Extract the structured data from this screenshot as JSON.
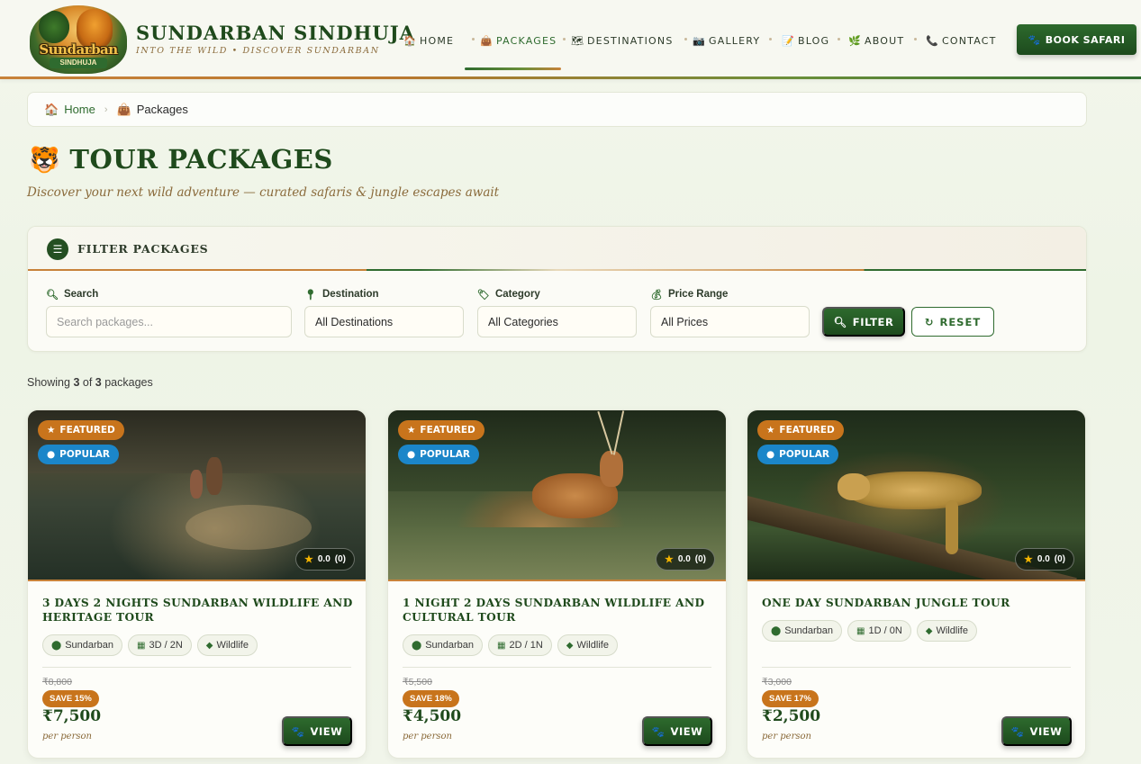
{
  "brand": {
    "logo_text": "Sundarban",
    "logo_subtext": "SINDHUJA",
    "title": "SUNDARBAN SINDHUJA",
    "tagline": "INTO THE WILD  •  DISCOVER SUNDARBAN"
  },
  "nav": {
    "items": [
      {
        "label": "HOME",
        "icon": "home-icon"
      },
      {
        "label": "PACKAGES",
        "icon": "bag-icon",
        "active": true
      },
      {
        "label": "DESTINATIONS",
        "icon": "map-icon"
      },
      {
        "label": "GALLERY",
        "icon": "camera-icon"
      },
      {
        "label": "BLOG",
        "icon": "memo-icon"
      },
      {
        "label": "ABOUT",
        "icon": "leaf-icon"
      },
      {
        "label": "CONTACT",
        "icon": "phone-icon"
      }
    ],
    "book_label": "BOOK SAFARI"
  },
  "breadcrumb": {
    "home": "Home",
    "current": "Packages"
  },
  "page": {
    "title": "TOUR PACKAGES",
    "subtitle": "Discover your next wild adventure — curated safaris & jungle escapes await"
  },
  "filter": {
    "title": "FILTER PACKAGES",
    "search_label": "Search",
    "search_placeholder": "Search packages...",
    "destination_label": "Destination",
    "destination_value": "All Destinations",
    "category_label": "Category",
    "category_value": "All Categories",
    "price_label": "Price Range",
    "price_value": "All Prices",
    "filter_button": "FILTER",
    "reset_button": "RESET"
  },
  "results": {
    "prefix": "Showing",
    "shown": "3",
    "of": "of",
    "total": "3",
    "suffix": "packages"
  },
  "labels": {
    "featured": "FEATURED",
    "popular": "POPULAR",
    "per_person": "per person",
    "view": "VIEW"
  },
  "packages": [
    {
      "title": "3 Days 2 Nights Sundarban Wildlife and Heritage Tour",
      "rating": "0.0",
      "reviews": "(0)",
      "location": "Sundarban",
      "duration": "3D / 2N",
      "category": "Wildlife",
      "old_price": "₹8,800",
      "save": "SAVE 15%",
      "price": "₹7,500"
    },
    {
      "title": "1 Night 2 Days Sundarban Wildlife and Cultural Tour",
      "rating": "0.0",
      "reviews": "(0)",
      "location": "Sundarban",
      "duration": "2D / 1N",
      "category": "Wildlife",
      "old_price": "₹5,500",
      "save": "SAVE 18%",
      "price": "₹4,500"
    },
    {
      "title": "One Day Sundarban Jungle Tour",
      "rating": "0.0",
      "reviews": "(0)",
      "location": "Sundarban",
      "duration": "1D / 0N",
      "category": "Wildlife",
      "old_price": "₹3,000",
      "save": "SAVE 17%",
      "price": "₹2,500"
    }
  ],
  "colors": {
    "primary_green": "#1f4a1c",
    "accent_orange": "#c8741c",
    "popular_blue": "#1b86c9",
    "background": "#eef4e6"
  }
}
